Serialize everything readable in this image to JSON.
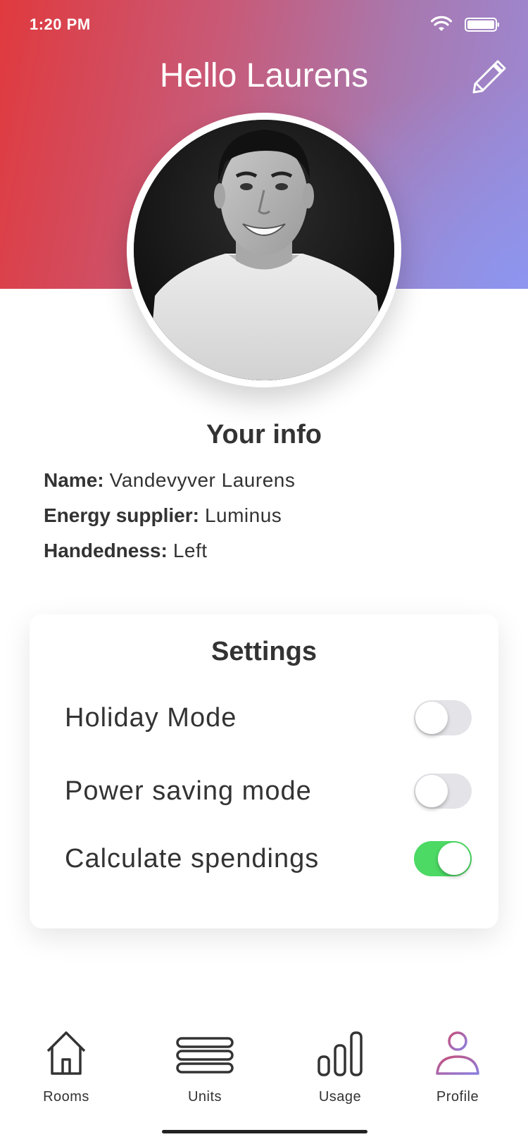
{
  "status_bar": {
    "time": "1:20 PM",
    "wifi_icon": "wifi-icon",
    "battery_icon": "battery-icon"
  },
  "header": {
    "title": "Hello Laurens",
    "edit_icon": "pencil-icon",
    "gradient_start": "#e03a3e",
    "gradient_end": "#8c96f0"
  },
  "profile": {
    "avatar_alt": "profile photo"
  },
  "info": {
    "title": "Your info",
    "rows": [
      {
        "label": "Name:",
        "value": "Vandevyver Laurens"
      },
      {
        "label": "Energy supplier:",
        "value": "Luminus"
      },
      {
        "label": "Handedness:",
        "value": "Left"
      }
    ]
  },
  "settings": {
    "title": "Settings",
    "items": [
      {
        "label": "Holiday Mode",
        "enabled": false
      },
      {
        "label": "Power saving mode",
        "enabled": false
      },
      {
        "label": "Calculate spendings",
        "enabled": true
      }
    ],
    "toggle_on_color": "#4cd964",
    "toggle_off_color": "#e4e4e8"
  },
  "tabbar": {
    "tabs": [
      {
        "label": "Rooms",
        "icon": "house-icon",
        "active": false
      },
      {
        "label": "Units",
        "icon": "units-icon",
        "active": false
      },
      {
        "label": "Usage",
        "icon": "bar-chart-icon",
        "active": false
      },
      {
        "label": "Profile",
        "icon": "person-icon",
        "active": true
      }
    ],
    "active_gradient": [
      "#c8507a",
      "#8a7ee0"
    ]
  }
}
